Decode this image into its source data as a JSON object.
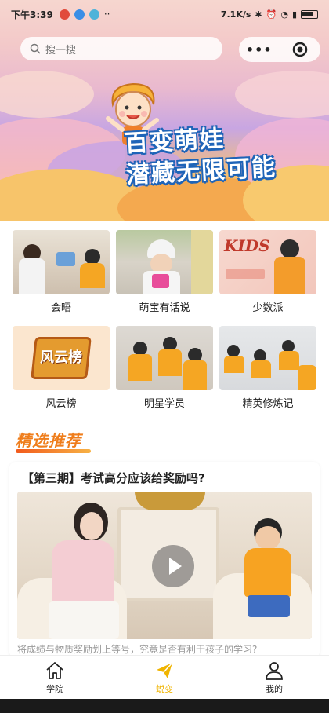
{
  "status": {
    "time": "下午3:39",
    "speed": "7.1K/s",
    "battery": "41"
  },
  "search": {
    "placeholder": "搜一搜"
  },
  "capsule": {
    "more": "•••"
  },
  "hero": {
    "line1": "百变萌娃",
    "line2": "潜藏无限可能"
  },
  "grid": {
    "items": [
      {
        "label": "会晤"
      },
      {
        "label": "萌宝有话说"
      },
      {
        "label": "少数派",
        "badge": "KIDS"
      },
      {
        "label": "风云榜",
        "badge": "风云榜"
      },
      {
        "label": "明星学员"
      },
      {
        "label": "精英修炼记"
      }
    ]
  },
  "section": {
    "title": "精选推荐"
  },
  "card": {
    "title": "【第三期】考试高分应该给奖励吗?",
    "caption": "将成绩与物质奖励划上等号，究竟是否有利于孩子的学习?"
  },
  "tabs": [
    {
      "label": "学院",
      "icon": "home-icon"
    },
    {
      "label": "蜕变",
      "icon": "send-icon"
    },
    {
      "label": "我的",
      "icon": "user-icon"
    }
  ],
  "colors": {
    "accent": "#ef7d1b",
    "active_tab": "#f0b400"
  }
}
